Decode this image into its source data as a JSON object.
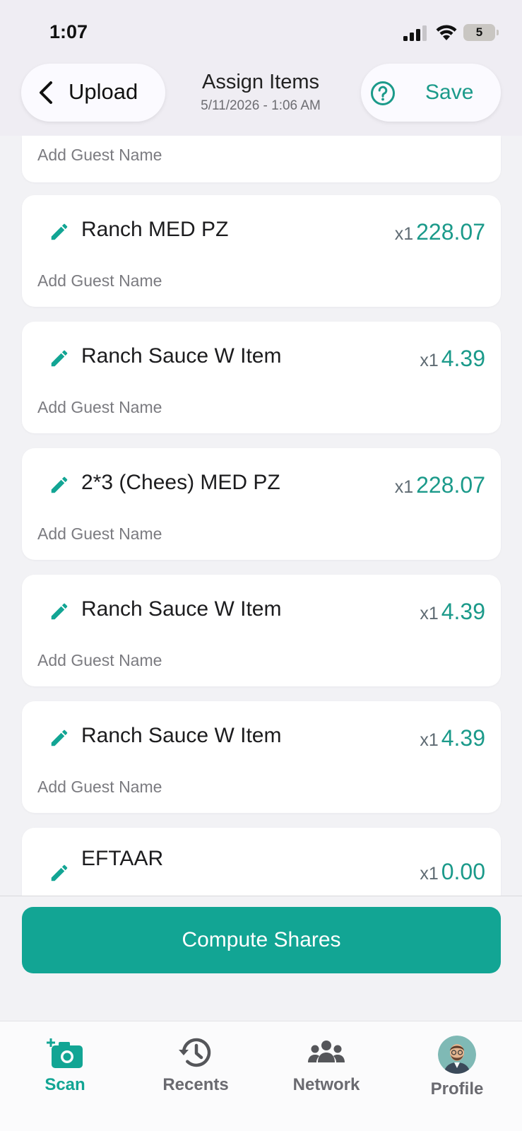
{
  "status_bar": {
    "time": "1:07",
    "battery": "5"
  },
  "header": {
    "back_label": "Upload",
    "title": "Assign Items",
    "subtitle": "5/11/2026 - 1:06 AM",
    "save_label": "Save"
  },
  "items": [
    {
      "name": "",
      "qty": "",
      "price": "",
      "guest_placeholder": "Add Guest Name"
    },
    {
      "name": "Ranch MED PZ",
      "qty": "x1",
      "price": "228.07",
      "guest_placeholder": "Add Guest Name"
    },
    {
      "name": "Ranch Sauce W Item",
      "qty": "x1",
      "price": "4.39",
      "guest_placeholder": "Add Guest Name"
    },
    {
      "name": "2*3 (Chees) MED PZ",
      "qty": "x1",
      "price": "228.07",
      "guest_placeholder": "Add Guest Name"
    },
    {
      "name": "Ranch Sauce W Item",
      "qty": "x1",
      "price": "4.39",
      "guest_placeholder": "Add Guest Name"
    },
    {
      "name": "Ranch Sauce W Item",
      "qty": "x1",
      "price": "4.39",
      "guest_placeholder": "Add Guest Name"
    },
    {
      "name": "EFTAAR",
      "qty": "x1",
      "price": "0.00",
      "guest_placeholder": ""
    }
  ],
  "compute_button": "Compute Shares",
  "tabs": [
    {
      "label": "Scan",
      "icon": "camera-plus-icon",
      "active": true
    },
    {
      "label": "Recents",
      "icon": "history-icon",
      "active": false
    },
    {
      "label": "Network",
      "icon": "people-icon",
      "active": false
    },
    {
      "label": "Profile",
      "icon": "avatar",
      "active": false
    }
  ],
  "colors": {
    "accent": "#12a594",
    "accent_text": "#1b9a8a",
    "background": "#f2f2f5",
    "header": "#efedf3"
  }
}
